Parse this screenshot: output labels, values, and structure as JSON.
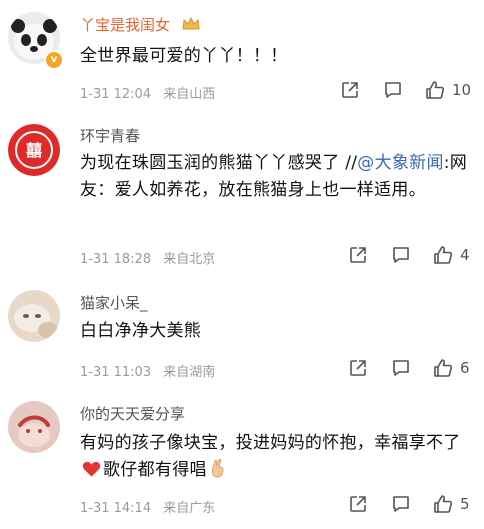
{
  "comments": [
    {
      "username": "丫宝是我闺女",
      "text": "全世界最可爱的丫丫！！！",
      "date": "1-31 12:04",
      "location": "来自山西",
      "likes": "10"
    },
    {
      "username": "环宇青春",
      "text_pre": "为现在珠圆玉润的熊猫丫丫感哭了 //",
      "text_link": "@大象新闻",
      "text_post": ":网友：爱人如养花，放在熊猫身上也一样适用。",
      "date": "1-31 18:28",
      "location": "来自北京",
      "likes": "4"
    },
    {
      "username": "猫家小呆_",
      "text": "白白净净大美熊",
      "date": "1-31 11:03",
      "location": "来自湖南",
      "likes": "6"
    },
    {
      "username": "你的天天爱分享",
      "text_pre": "有妈的孩子像块宝，投进妈妈的怀抱，幸福享不了",
      "text_post": "歌仔都有得唱",
      "date": "1-31 14:14",
      "location": "来自广东",
      "likes": "5"
    }
  ],
  "colors": {
    "link": "#3b6bb5",
    "meta": "#9a9a9a",
    "heart": "#e8342e"
  }
}
